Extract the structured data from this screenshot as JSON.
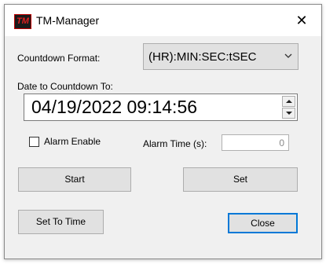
{
  "window": {
    "title": "TM-Manager",
    "app_icon_text": "TM",
    "close_glyph": "✕"
  },
  "countdown_format": {
    "label": "Countdown Format:",
    "selected": "(HR):MIN:SEC:tSEC"
  },
  "date_to": {
    "label": "Date to Countdown To:",
    "value": "04/19/2022 09:14:56"
  },
  "alarm": {
    "enable_label": "Alarm Enable",
    "enabled": false,
    "time_label": "Alarm Time (s):",
    "time_value": "0"
  },
  "buttons": {
    "start": "Start",
    "set": "Set",
    "set_to_time": "Set To Time",
    "close": "Close"
  },
  "colors": {
    "default_button_border": "#0078d7",
    "icon_red": "#e02020"
  }
}
